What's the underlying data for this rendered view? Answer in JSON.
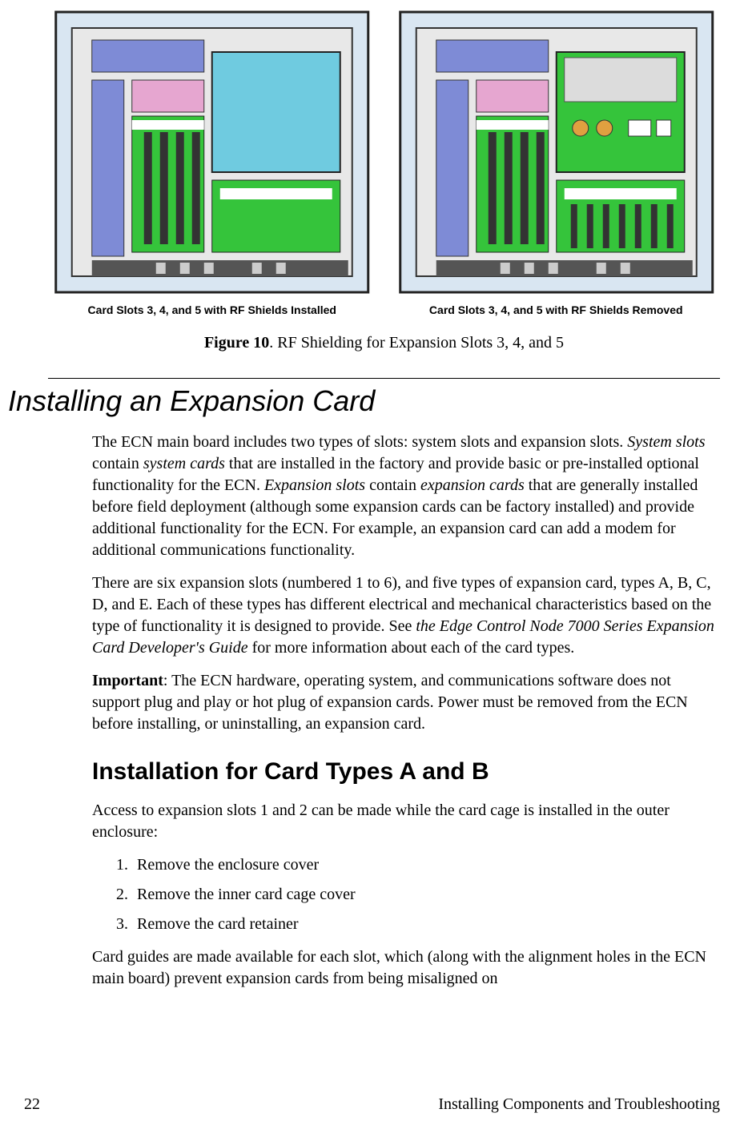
{
  "figure": {
    "left_caption": "Card Slots 3, 4, and 5 with RF Shields Installed",
    "right_caption": "Card Slots 3, 4, and 5 with RF Shields Removed",
    "number_label": "Figure 10",
    "title": ". RF Shielding for Expansion Slots 3, 4, and 5"
  },
  "heading_main": "Installing an Expansion Card",
  "para1_a": "The ECN main board includes two types of slots:  system slots and expansion slots.  ",
  "para1_b": "System slots",
  "para1_c": " contain ",
  "para1_d": "system cards",
  "para1_e": " that are installed in the factory and provide basic or pre-installed optional functionality for the ECN.  ",
  "para1_f": "Expansion slots",
  "para1_g": " contain ",
  "para1_h": "expansion cards",
  "para1_i": " that are generally installed before field deployment (although some expansion cards can be factory installed) and provide additional functionality for the ECN.  For example, an expansion card can add a modem for additional communications functionality.",
  "para2_a": "There are six expansion slots (numbered 1 to 6), and five types of expansion card, types A, B, C, D, and E.  Each of these types has different electrical and mechanical characteristics based on the type of functionality it is designed to provide.  See ",
  "para2_b": "the Edge Control Node 7000 Series Expansion Card Developer's Guide",
  "para2_c": " for more information about each of the card types.",
  "para3_a": "Important",
  "para3_b": ":  The ECN hardware, operating system, and communications software does not support plug and play or hot plug of expansion cards.  Power must be removed from the ECN before installing, or uninstalling, an expansion card.",
  "heading_sub": "Installation for Card Types A and B",
  "para4": "Access to expansion slots 1 and 2 can be made while the card cage is installed in the outer enclosure:",
  "steps": [
    "Remove the enclosure cover",
    "Remove the inner card cage cover",
    "Remove the card retainer"
  ],
  "para5": "Card guides are made available for each slot, which (along with the alignment holes in the ECN main board) prevent expansion cards from being misaligned on",
  "footer": {
    "page_num": "22",
    "section": "Installing Components and Troubleshooting"
  }
}
